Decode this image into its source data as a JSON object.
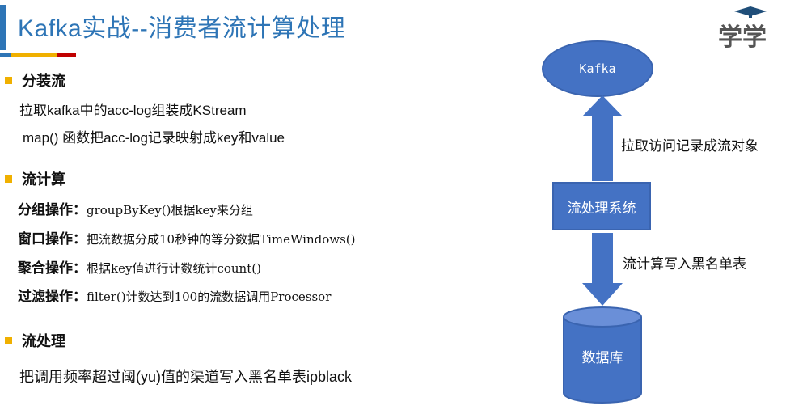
{
  "title": "Kafka实战--消费者流计算处理",
  "logo_text": "学学",
  "colors": {
    "title_blue": "#2e75b6",
    "shape_blue": "#4472c4",
    "bullet_yellow": "#f0b000",
    "underline": [
      "#2e75b6",
      "#f0b000",
      "#c00000"
    ]
  },
  "sections": [
    {
      "heading": "分装流",
      "lines": [
        "拉取kafka中的acc-log组装成KStream",
        "map() 函数把acc-log记录映射成key和value"
      ]
    },
    {
      "heading": "流计算",
      "ops": [
        {
          "label": "分组操作：",
          "text": "groupByKey()根据key来分组"
        },
        {
          "label": "窗口操作：",
          "text": "把流数据分成10秒钟的等分数据TimeWindows()"
        },
        {
          "label": "聚合操作：",
          "text": "根据key值进行计数统计count()"
        },
        {
          "label": "过滤操作：",
          "text": "filter()计数达到100的流数据调用Processor"
        }
      ]
    },
    {
      "heading": "流处理",
      "lines": [
        "把调用频率超过阈(yu)值的渠道写入黑名单表ipblack"
      ]
    }
  ],
  "diagram": {
    "top_node": "Kafka",
    "middle_node": "流处理系统",
    "bottom_node": "数据库",
    "up_arrow_label": "拉取访问记录成流对象",
    "down_arrow_label": "流计算写入黑名单表"
  }
}
